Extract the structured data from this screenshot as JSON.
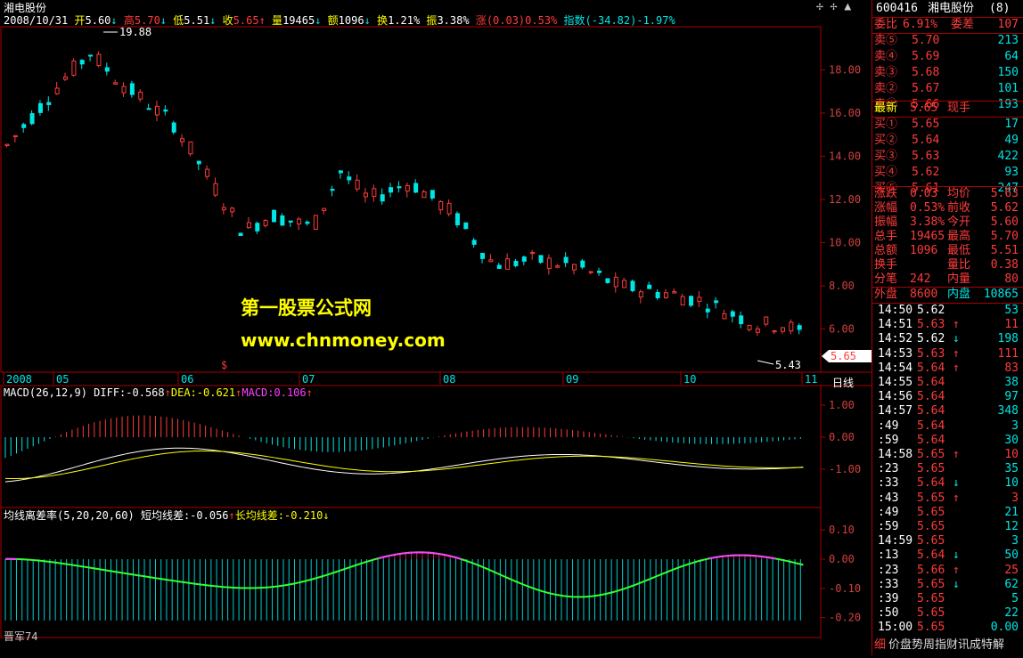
{
  "stock_title": "湘电股份",
  "info_bar": {
    "date": "2008/10/31",
    "open_label": "开",
    "open": "5.60",
    "high_label": "高",
    "high": "5.70",
    "low_label": "低",
    "low": "5.51",
    "close_label": "收",
    "close": "5.65",
    "vol_label": "量",
    "vol": "19465",
    "amt_label": "额",
    "amt": "1096",
    "turn_label": "换",
    "turn": "1.21%",
    "amp_label": "振",
    "amp": "3.38%",
    "chg_label": "涨",
    "chg": "(0.03)0.53%",
    "idx_label": "指数",
    "idx": "(-34.82)-1.97%"
  },
  "price_axis": [
    "18.00",
    "16.00",
    "14.00",
    "12.00",
    "10.00",
    "8.00",
    "6.00"
  ],
  "peak_label": "19.88",
  "trough_label": "5.43",
  "current_price_tag": "5.65",
  "month_axis": [
    "2008",
    "05",
    "06",
    "07",
    "08",
    "09",
    "10",
    "11"
  ],
  "period_label": "日线",
  "watermark": {
    "line1": "第一股票公式网",
    "line2": "www.chnmoney.com"
  },
  "ex_rights_marker": "$",
  "macd": {
    "title": "MACD(26,12,9)",
    "diff_label": "DIFF:",
    "diff": "-0.568",
    "dea_label": "DEA:",
    "dea": "-0.621",
    "macd_label": "MACD:",
    "macd": "0.106",
    "axis": [
      "1.00",
      "0.00",
      "-1.00"
    ]
  },
  "bias": {
    "title": "均线离差率(5,20,20,60)",
    "short_label": "短均线差:",
    "short": "-0.056",
    "long_label": "长均线差:",
    "long": "-0.210",
    "axis": [
      "0.10",
      "0.00",
      "-0.10",
      "-0.20"
    ]
  },
  "author": "晋军74",
  "panel": {
    "code": "600416",
    "name": "湘电股份",
    "suffix": "(8)",
    "weibi_label": "委比",
    "weibi": "6.91%",
    "weicha_label": "委差",
    "weicha": "107",
    "asks": [
      {
        "label": "卖⑤",
        "price": "5.70",
        "vol": "213"
      },
      {
        "label": "卖④",
        "price": "5.69",
        "vol": "64"
      },
      {
        "label": "卖③",
        "price": "5.68",
        "vol": "150"
      },
      {
        "label": "卖②",
        "price": "5.67",
        "vol": "101"
      },
      {
        "label": "卖①",
        "price": "5.66",
        "vol": "193"
      }
    ],
    "latest_label": "最新",
    "latest": "5.65",
    "latest_suffix": "现手",
    "bids": [
      {
        "label": "买①",
        "price": "5.65",
        "vol": "17"
      },
      {
        "label": "买②",
        "price": "5.64",
        "vol": "49"
      },
      {
        "label": "买③",
        "price": "5.63",
        "vol": "422"
      },
      {
        "label": "买④",
        "price": "5.62",
        "vol": "93"
      },
      {
        "label": "买⑤",
        "price": "5.61",
        "vol": "247"
      }
    ],
    "stats": [
      {
        "l1": "涨跌",
        "v1": "0.03",
        "l2": "均价",
        "v2": "5.63"
      },
      {
        "l1": "涨幅",
        "v1": "0.53%",
        "l2": "前收",
        "v2": "5.62"
      },
      {
        "l1": "振幅",
        "v1": "3.38%",
        "l2": "今开",
        "v2": "5.60"
      },
      {
        "l1": "总手",
        "v1": "19465",
        "l2": "最高",
        "v2": "5.70"
      },
      {
        "l1": "总额",
        "v1": "1096",
        "l2": "最低",
        "v2": "5.51"
      },
      {
        "l1": "换手",
        "v1": "",
        "l2": "量比",
        "v2": "0.38"
      },
      {
        "l1": "分笔",
        "v1": "242",
        "l2": "内量",
        "v2": "80"
      }
    ],
    "outer_label": "外盘",
    "outer": "8600",
    "inner_label": "内盘",
    "inner": "10865",
    "ticks": [
      {
        "t": "14:50",
        "p": "5.62",
        "d": "",
        "v": "53"
      },
      {
        "t": "14:51",
        "p": "5.63",
        "d": "↑",
        "v": "11"
      },
      {
        "t": "14:52",
        "p": "5.62",
        "d": "↓",
        "v": "198"
      },
      {
        "t": "14:53",
        "p": "5.63",
        "d": "↑",
        "v": "111"
      },
      {
        "t": "14:54",
        "p": "5.64",
        "d": "↑",
        "v": "83"
      },
      {
        "t": "14:55",
        "p": "5.64",
        "d": "",
        "v": "38"
      },
      {
        "t": "14:56",
        "p": "5.64",
        "d": "",
        "v": "97"
      },
      {
        "t": "14:57",
        "p": "5.64",
        "d": "",
        "v": "348"
      },
      {
        "t": ":49",
        "p": "5.64",
        "d": "",
        "v": "3"
      },
      {
        "t": ":59",
        "p": "5.64",
        "d": "",
        "v": "30"
      },
      {
        "t": "14:58",
        "p": "5.65",
        "d": "↑",
        "v": "10"
      },
      {
        "t": ":23",
        "p": "5.65",
        "d": "",
        "v": "35"
      },
      {
        "t": ":33",
        "p": "5.64",
        "d": "↓",
        "v": "10"
      },
      {
        "t": ":43",
        "p": "5.65",
        "d": "↑",
        "v": "3"
      },
      {
        "t": ":49",
        "p": "5.65",
        "d": "",
        "v": "21"
      },
      {
        "t": ":59",
        "p": "5.65",
        "d": "",
        "v": "12"
      },
      {
        "t": "14:59",
        "p": "5.65",
        "d": "",
        "v": "3"
      },
      {
        "t": ":13",
        "p": "5.64",
        "d": "↓",
        "v": "50"
      },
      {
        "t": ":23",
        "p": "5.66",
        "d": "↑",
        "v": "25"
      },
      {
        "t": ":33",
        "p": "5.65",
        "d": "↓",
        "v": "62"
      },
      {
        "t": ":39",
        "p": "5.65",
        "d": "",
        "v": "5"
      },
      {
        "t": ":50",
        "p": "5.65",
        "d": "",
        "v": "22"
      },
      {
        "t": "15:00",
        "p": "5.65",
        "d": "",
        "v": "0.00"
      }
    ],
    "bottom_tabs": {
      "first": "细",
      "rest": "价盘势周指财讯成特解"
    }
  },
  "colors": {
    "up": "#ff3b3b",
    "down": "#00e5e5",
    "border": "#aa0000",
    "yellow": "#ffff00",
    "magenta": "#ff40ff",
    "green": "#33ff33"
  }
}
